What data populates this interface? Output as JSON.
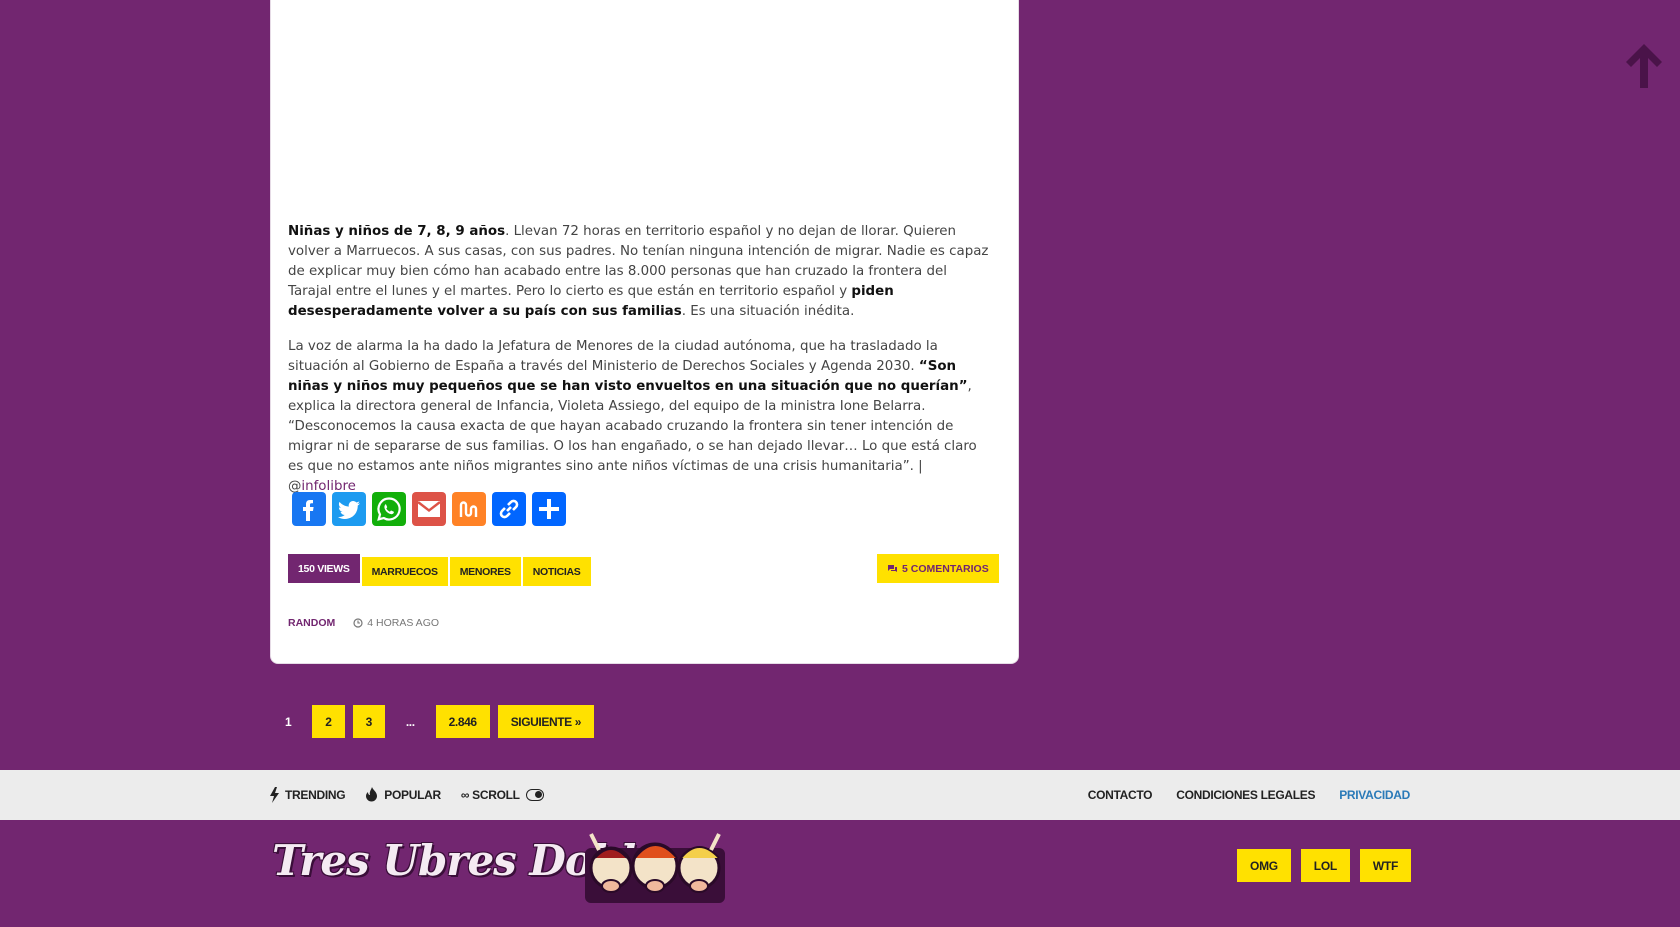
{
  "article": {
    "p1": {
      "b1": "Niñas y niños de 7, 8, 9 años",
      "t1": ". Llevan 72 horas en territorio español y no dejan de llorar. Quieren volver a Marruecos. A sus casas, con sus padres. No tenían ninguna intención de migrar. Nadie es capaz de explicar muy bien cómo han acabado entre las 8.000 personas que han cruzado la frontera del Tarajal entre el lunes y el martes. Pero lo cierto es que están en territorio español y ",
      "b2": "piden desesperadamente volver a su país con sus familias",
      "t2": ". Es una situación inédita."
    },
    "p2": {
      "t1": "La voz de alarma la ha dado la Jefatura de Menores de la ciudad autónoma, que ha trasladado la situación al Gobierno de España a través del Ministerio de Derechos Sociales y Agenda 2030. ",
      "b1": "“Son niñas y niños muy pequeños que se han visto envueltos en una situación que no querían”",
      "t2": ", explica la directora general de Infancia, Violeta Assiego, del equipo de la ministra Ione Belarra. “Desconocemos la causa exacta de que hayan acabado cruzando la frontera sin tener intención de migrar ni de separarse de sus familias. O los han engañado, o se han dejado llevar… Lo que está claro es que no estamos ante niños migrantes sino ante niños víctimas de una crisis humanitaria”. | @",
      "link": "infolibre"
    }
  },
  "share": {
    "items": [
      {
        "name": "facebook",
        "color": "#1877f2",
        "icon": "facebook-icon"
      },
      {
        "name": "twitter",
        "color": "#1d9bf0",
        "icon": "twitter-icon"
      },
      {
        "name": "whatsapp",
        "color": "#12af0a",
        "icon": "whatsapp-icon"
      },
      {
        "name": "gmail",
        "color": "#dd5347",
        "icon": "gmail-icon"
      },
      {
        "name": "mix",
        "color": "#ff8226",
        "icon": "mix-icon"
      },
      {
        "name": "copy-link",
        "color": "#0166ff",
        "icon": "link-icon"
      },
      {
        "name": "share",
        "color": "#0166ff",
        "icon": "share-icon"
      }
    ]
  },
  "post_meta": {
    "views": "150 VIEWS",
    "tags": [
      "MARRUECOS",
      "MENORES",
      "NOTICIAS"
    ],
    "comments": "5 COMENTARIOS",
    "category": "RANDOM",
    "time": "4 HORAS AGO"
  },
  "pagination": {
    "current": "1",
    "pages": [
      "2",
      "3"
    ],
    "dots": "...",
    "last": "2.846",
    "next": "SIGUIENTE »"
  },
  "navbar": {
    "trending": "TRENDING",
    "popular": "POPULAR",
    "scroll": "∞ SCROLL",
    "links": [
      "CONTACTO",
      "CONDICIONES LEGALES",
      "PRIVACIDAD"
    ]
  },
  "footer": {
    "logo": "Tres Ubres Dobles",
    "buttons": [
      "OMG",
      "LOL",
      "WTF"
    ]
  },
  "colors": {
    "brand": "#722670",
    "accent": "#ffe100",
    "nav_bg": "#ececec",
    "active_link": "#2a7ab8"
  }
}
